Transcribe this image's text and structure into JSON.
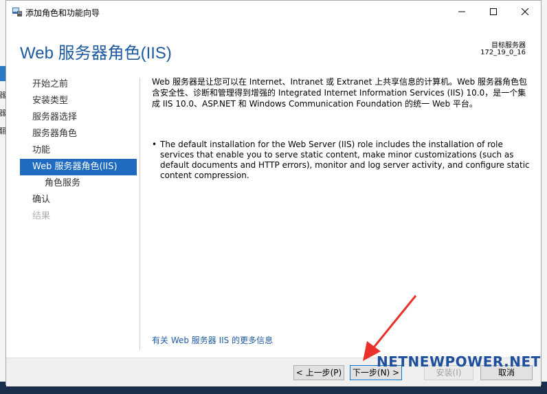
{
  "window": {
    "title": "添加角色和功能向导"
  },
  "header": {
    "page_title": "Web 服务器角色(IIS)",
    "target_label": "目标服务器",
    "target_value": "172_19_0_16"
  },
  "nav": {
    "items": [
      {
        "label": "开始之前",
        "state": "normal"
      },
      {
        "label": "安装类型",
        "state": "normal"
      },
      {
        "label": "服务器选择",
        "state": "normal"
      },
      {
        "label": "服务器角色",
        "state": "normal"
      },
      {
        "label": "功能",
        "state": "normal"
      },
      {
        "label": "Web 服务器角色(IIS)",
        "state": "active"
      },
      {
        "label": "角色服务",
        "state": "sub"
      },
      {
        "label": "确认",
        "state": "normal"
      },
      {
        "label": "结果",
        "state": "disabled"
      }
    ]
  },
  "content": {
    "description": "Web 服务器是让您可以在 Internet、Intranet 或 Extranet 上共享信息的计算机。Web 服务器角色包含安全性、诊断和管理得到增强的 Integrated Internet Information Services (IIS) 10.0，是一个集成 IIS 10.0、ASP.NET 和 Windows Communication Foundation 的统一 Web 平台。",
    "bullet": "The default installation for the Web Server (IIS) role includes the installation of role services that enable you to serve static content, make minor customizations (such as default documents and HTTP errors), monitor and log server activity, and configure static content compression.",
    "more_link": "有关 Web 服务器 IIS 的更多信息"
  },
  "footer": {
    "prev_label": "< 上一步(P)",
    "next_label": "下一步(N) >",
    "install_label": "安装(I)",
    "cancel_label": "取消"
  },
  "watermark": "NETNEWPOWER.NET",
  "desktop_glyphs": [
    "器",
    "器",
    "翻"
  ],
  "colors": {
    "accent": "#1e6bc1",
    "title_blue": "#1e5aa0",
    "annotation_arrow": "#e8312a"
  }
}
